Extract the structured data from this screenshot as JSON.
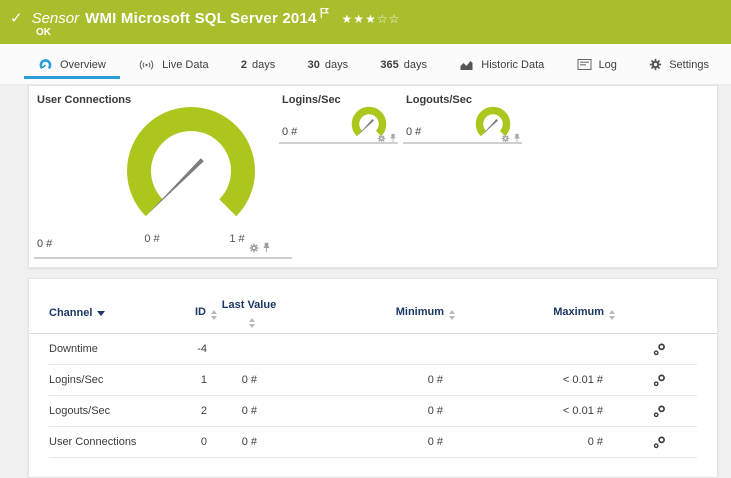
{
  "header": {
    "type_label": "Sensor",
    "title": "WMI Microsoft SQL Server 2014",
    "status": "OK",
    "stars_filled": "★★★",
    "stars_empty": "☆☆",
    "bg_color": "#a9be2c"
  },
  "tabs": {
    "overview": "Overview",
    "live_data": "Live Data",
    "d2_num": "2",
    "d2_label": "days",
    "d30_num": "30",
    "d30_label": "days",
    "d365_num": "365",
    "d365_label": "days",
    "historic": "Historic Data",
    "log": "Log",
    "settings": "Settings",
    "active_tab": "Overview",
    "accent_color": "#2b9fd8"
  },
  "gauges": {
    "arc_color": "#adc61e",
    "needle_color": "#7d7d7d",
    "primary": {
      "title": "User Connections",
      "value": "0 #",
      "scale_min": "0 #",
      "scale_max": "1 #"
    },
    "logins": {
      "title": "Logins/Sec",
      "value": "0 #"
    },
    "logouts": {
      "title": "Logouts/Sec",
      "value": "0 #"
    }
  },
  "table": {
    "header_color": "#1a3866",
    "columns": {
      "channel": "Channel",
      "id": "ID",
      "last_value": "Last Value",
      "minimum": "Minimum",
      "maximum": "Maximum"
    },
    "rows": [
      {
        "channel": "Downtime",
        "id": "-4",
        "last": "",
        "min": "",
        "max": ""
      },
      {
        "channel": "Logins/Sec",
        "id": "1",
        "last": "0 #",
        "min": "0 #",
        "max": "< 0.01 #"
      },
      {
        "channel": "Logouts/Sec",
        "id": "2",
        "last": "0 #",
        "min": "0 #",
        "max": "< 0.01 #"
      },
      {
        "channel": "User Connections",
        "id": "0",
        "last": "0 #",
        "min": "0 #",
        "max": "0 #"
      }
    ]
  }
}
